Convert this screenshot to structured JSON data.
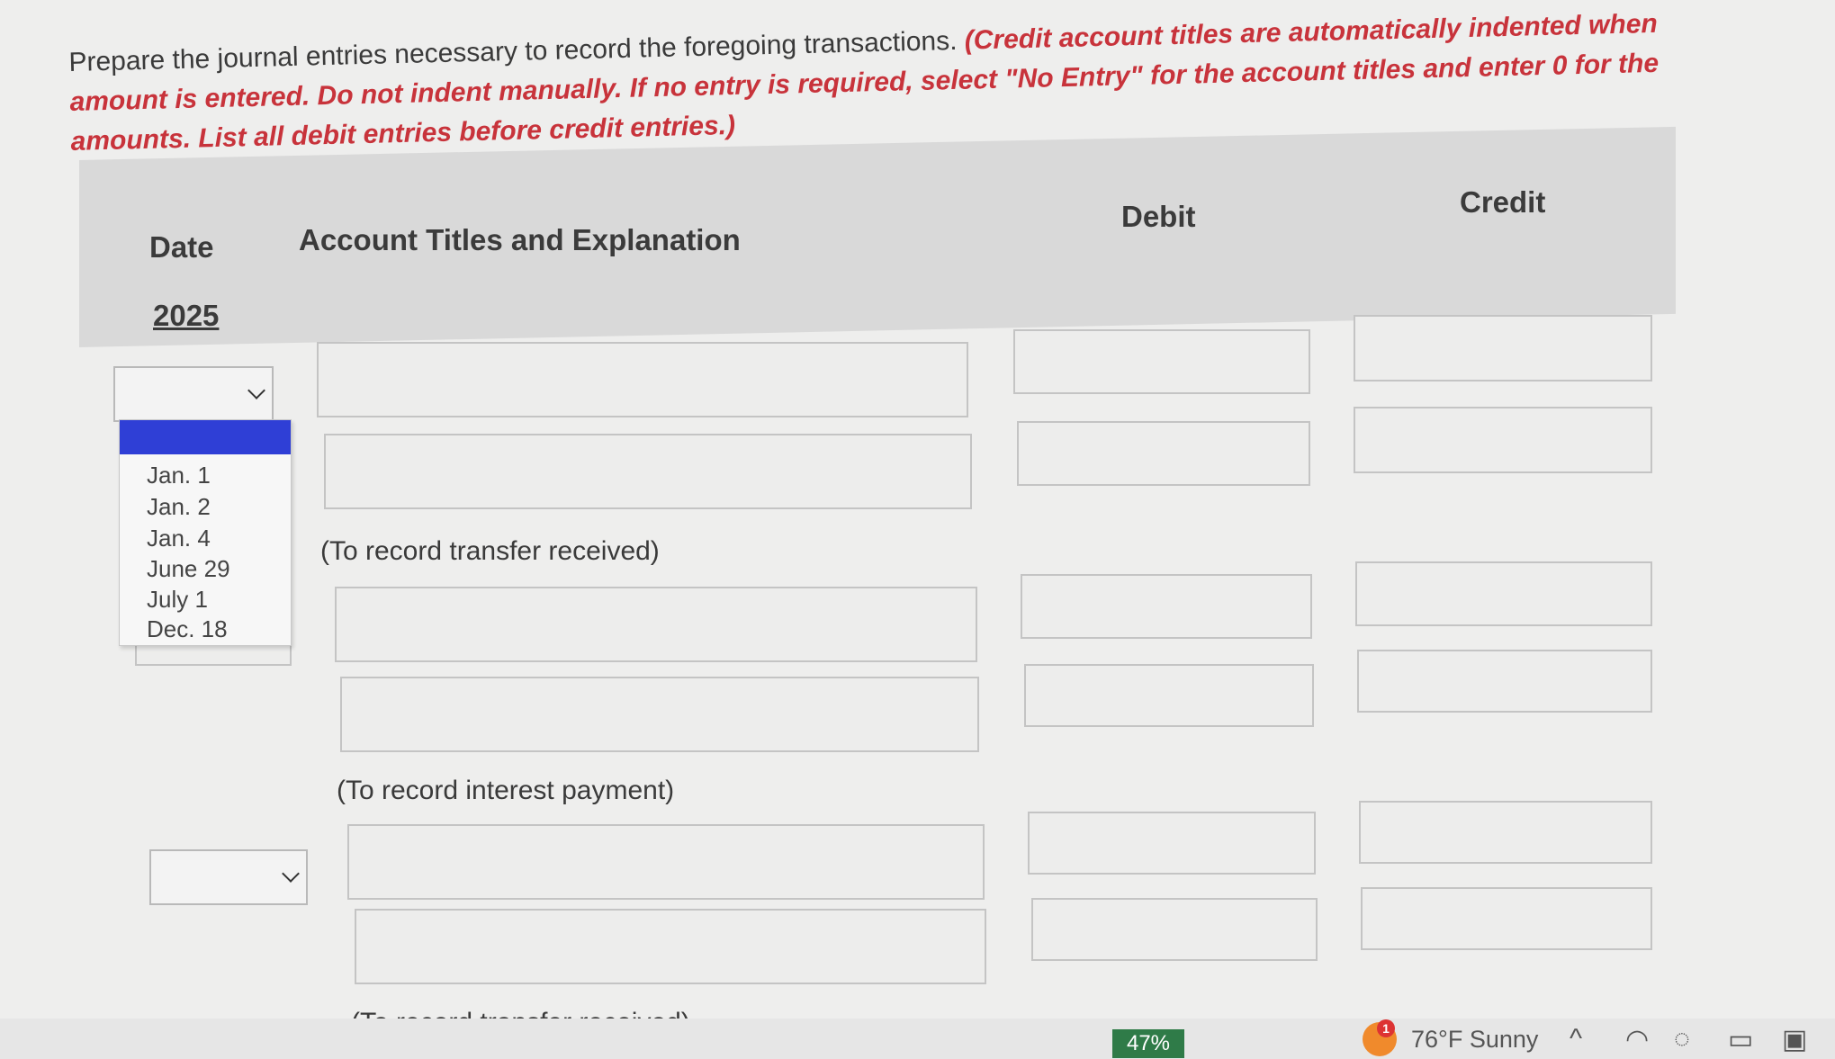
{
  "instructions": {
    "plain": "Prepare the journal entries necessary to record the foregoing transactions.",
    "emphasis": "(Credit account titles are automatically indented when amount is entered. Do not indent manually. If no entry is required, select \"No Entry\" for the account titles and enter 0 for the amounts. List all debit entries before credit entries.)"
  },
  "table": {
    "headers": {
      "date": "Date",
      "account": "Account Titles and Explanation",
      "debit": "Debit",
      "credit": "Credit"
    },
    "year": "2025"
  },
  "date_dropdown": {
    "options": [
      "Jan. 1",
      "Jan. 2",
      "Jan. 4",
      "June 29",
      "July 1",
      "Dec. 18"
    ]
  },
  "notes": {
    "entry1": "(To record transfer received)",
    "entry2": "(To record interest payment)",
    "entry3": "(To record transfer received)"
  },
  "taskbar": {
    "battery": "47%",
    "weather": "76°F  Sunny",
    "weather_badge": "1"
  },
  "colors": {
    "emphasis_red": "#c8333b",
    "dropdown_highlight": "#2f3fd6",
    "header_band": "#d9d9d9"
  }
}
